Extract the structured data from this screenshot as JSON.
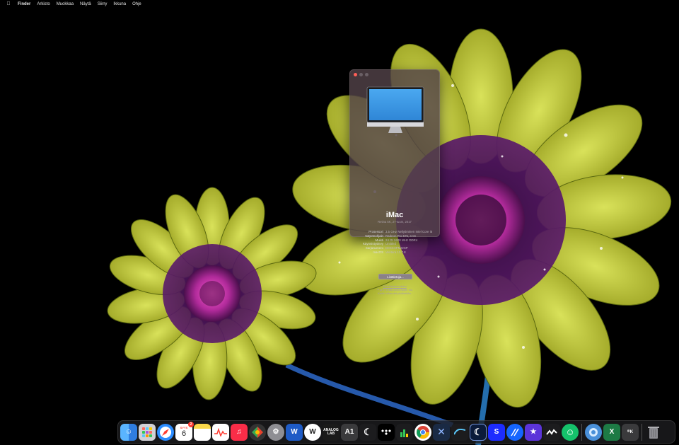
{
  "menubar": {
    "apple_icon": "apple-icon",
    "app_name": "Finder",
    "items": [
      "Arkisto",
      "Muokkaa",
      "Näytä",
      "Siirry",
      "Ikkuna",
      "Ohje"
    ]
  },
  "about_window": {
    "model": "iMac",
    "subtitle": "Retina 5K, 27-tuum, 2017",
    "specs": [
      {
        "label": "Prosessori",
        "value": "3,5 GHz Neliytiminen Intel Core i5"
      },
      {
        "label": "Näytönohjain",
        "value": "Radeon Pro 575, 4 Gt"
      },
      {
        "label": "Muisti",
        "value": "24 Gt 2400 MHz DDR4"
      },
      {
        "label": "Käynnistyslevy",
        "value": "Untitled"
      },
      {
        "label": "Sarjanumero",
        "value": "D0XKHPMJ2SP"
      },
      {
        "label": "macOS",
        "value": "Ventura 13.7.8"
      }
    ],
    "more_button": "Lisätietoja...",
    "legal_link": "Säädöstietoindeksi",
    "copyright_line1": "™ ja © 1983–2025 Apple Inc.",
    "copyright_line2": "Kaikki oikeudet pidätetään."
  },
  "dock": {
    "calendar": {
      "month": "SYYS",
      "day": "6",
      "badge": "2"
    },
    "icons": [
      {
        "name": "finder-icon",
        "color": "#3d9bff"
      },
      {
        "name": "launchpad-icon",
        "color": "#c7c7cc"
      },
      {
        "name": "safari-icon",
        "color": "#2b8cff"
      },
      {
        "name": "calendar-icon",
        "color": "#ffffff"
      },
      {
        "name": "notes-icon",
        "color": "#fcd94a"
      },
      {
        "name": "activity-monitor-icon",
        "color": "#ffffff"
      },
      {
        "name": "music-icon",
        "color": "#fa2d48"
      },
      {
        "name": "chrome-like-icon",
        "color": "#3b3b3b"
      },
      {
        "name": "system-settings-icon",
        "color": "#8e8e93"
      },
      {
        "name": "word-icon",
        "color": "#1e5bc6"
      },
      {
        "name": "w-app-icon",
        "color": "#2a2a2a"
      },
      {
        "name": "analog-lab-icon",
        "color": "#1a1a1a"
      },
      {
        "name": "a1-icon",
        "color": "#3a3a3c"
      },
      {
        "name": "moon-icon",
        "color": "#1c1c1e"
      },
      {
        "name": "tidal-icon",
        "color": "#000000"
      },
      {
        "name": "chart-icon",
        "color": "#1c1c1e"
      },
      {
        "name": "chrome-icon",
        "color": "#ffffff"
      },
      {
        "name": "x-app-icon",
        "color": "#1a2a44"
      },
      {
        "name": "wave-icon",
        "color": "#1c1c1e"
      },
      {
        "name": "night-shift-icon",
        "color": "#0b1b3a"
      },
      {
        "name": "s-app-icon",
        "color": "#1d2cff"
      },
      {
        "name": "stripes-icon",
        "color": "#1565ff"
      },
      {
        "name": "star-icon",
        "color": "#5b34d9"
      },
      {
        "name": "squiggle-icon",
        "color": "#1c1c1e"
      },
      {
        "name": "smile-icon",
        "color": "#15c26b"
      },
      {
        "name": "downloads-icon",
        "color": "#4a90d9"
      },
      {
        "name": "excel-icon",
        "color": "#1d7a45"
      },
      {
        "name": "display-icon",
        "color": "#3a3a3c"
      },
      {
        "name": "trash-icon",
        "color": "#8e8e93"
      }
    ],
    "labels": {
      "analog": "ANALOG",
      "lab": "LAB",
      "a1": "A1",
      "box": "ᴵᴰK"
    }
  }
}
